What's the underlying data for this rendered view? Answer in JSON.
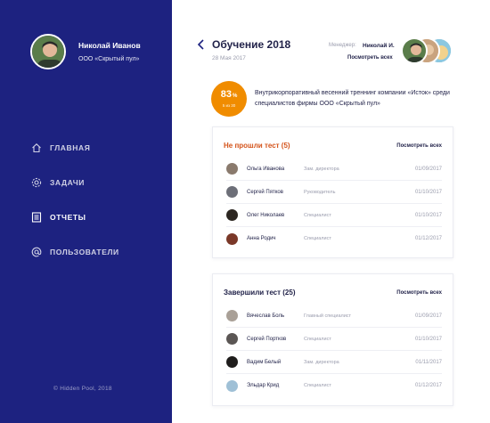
{
  "sidebar": {
    "user_name": "Николай Иванов",
    "company": "ООО «Скрытый пул»",
    "nav": [
      {
        "label": "ГЛАВНАЯ",
        "icon": "home-icon"
      },
      {
        "label": "ЗАДАЧИ",
        "icon": "gear-icon"
      },
      {
        "label": "ОТЧЕТЫ",
        "icon": "document-icon"
      },
      {
        "label": "ПОЛЬЗОВАТЕЛИ",
        "icon": "at-icon"
      }
    ],
    "copyright": "© Hidden Pool, 2018",
    "colors": {
      "bg": "#1d2280",
      "accent": "#ffffff"
    }
  },
  "header": {
    "title": "Обучение 2018",
    "date": "28 Мая 2017",
    "manager_label": "Менеджер:",
    "manager_name": "Николай И.",
    "see_all": "Посмотреть всех"
  },
  "progress": {
    "percent": "83",
    "unit": "%",
    "sub": "5 из 30",
    "color": "#f08c00",
    "description": "Внутрикорпоративный весенний треннинг компании «Исток» среди специалистов фирмы ООО «Скрытый пул»"
  },
  "failed": {
    "title": "Не прошли тест (5)",
    "link": "Посмотреть всех",
    "title_color": "#d4531a",
    "rows": [
      {
        "name": "Ольга Иванова",
        "role": "Зам. директора",
        "date": "01/09/2017"
      },
      {
        "name": "Сергей Пятков",
        "role": "Руководитель",
        "date": "01/10/2017"
      },
      {
        "name": "Олег Николаев",
        "role": "Специалист",
        "date": "01/10/2017"
      },
      {
        "name": "Анна Родич",
        "role": "Специалист",
        "date": "01/12/2017"
      }
    ]
  },
  "passed": {
    "title": "Завершили тест (25)",
    "link": "Посмотреть всех",
    "rows": [
      {
        "name": "Вячеслав Боль",
        "role": "Главный специалист",
        "date": "01/09/2017"
      },
      {
        "name": "Сергей Портков",
        "role": "Специалист",
        "date": "01/10/2017"
      },
      {
        "name": "Вадим Белый",
        "role": "Зам. директора",
        "date": "01/11/2017"
      },
      {
        "name": "Эльдар Крид",
        "role": "Специалист",
        "date": "01/12/2017"
      }
    ]
  }
}
